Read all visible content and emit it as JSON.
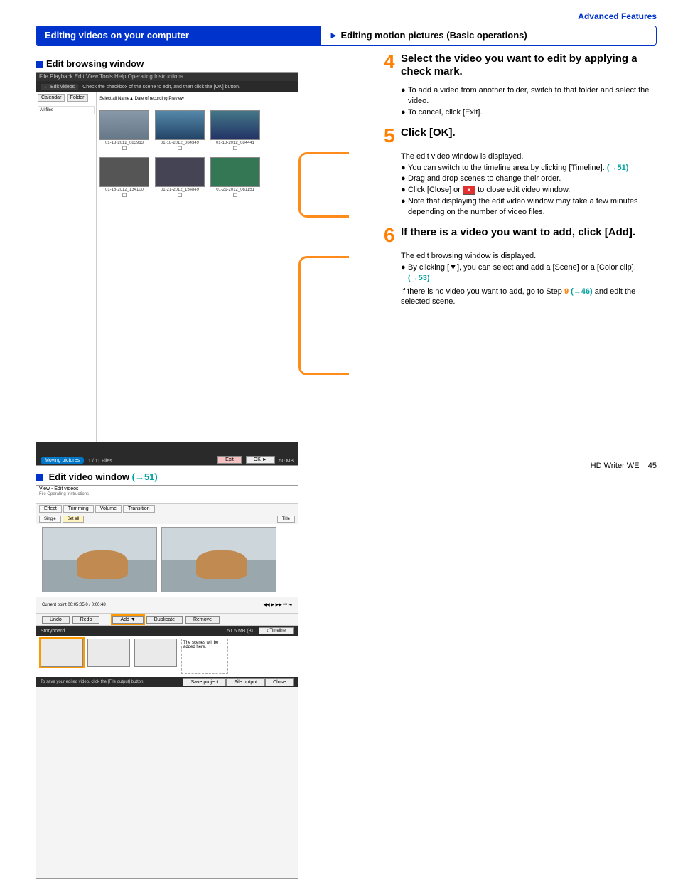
{
  "top_link": "Advanced Features",
  "header": {
    "left": "Editing videos on your computer",
    "right": "Editing motion pictures (Basic operations)"
  },
  "left_col": {
    "heading1": "Edit browsing window",
    "heading2_text": "Edit video window ",
    "heading2_link": "(→51)",
    "browsing": {
      "menu": "File   Playback   Edit   View   Tools   Help   Operating Instructions",
      "back_btn": "← Edit videos",
      "instr": "Check the checkbox of the scene to edit, and then click the [OK] button.",
      "side_tab1": "Calendar",
      "side_tab2": "Folder",
      "side_item": "All files",
      "cols": "Select all        Name▲        Date of recording        Preview",
      "thumbs": [
        {
          "name": "01-18-2012_083913"
        },
        {
          "name": "01-18-2012_084349"
        },
        {
          "name": "01-18-2012_084441"
        },
        {
          "name": "01-18-2012_134100"
        },
        {
          "name": "01-21-2012_154849"
        },
        {
          "name": "01-21-2012_081151"
        }
      ],
      "foot_label": "Moving pictures",
      "foot_count": "1 / 11 Files",
      "foot_exit": "Exit",
      "foot_ok": "OK ►",
      "foot_size": "50 MB"
    },
    "edit": {
      "title": "View - Edit videos",
      "menu": "File   Operating Instructions",
      "tabs": [
        "Effect",
        "Trimming",
        "Volume",
        "Transition"
      ],
      "subtabs": [
        "Single",
        "Set all",
        "Title"
      ],
      "time": "Current point    00:05:05.0 / 0:00:48",
      "btns": [
        "Undo",
        "Redo",
        "",
        "Add ▼",
        "Duplicate",
        "Remove"
      ],
      "story_head": "Storyboard",
      "story_note": "The scenes will be added here.",
      "story_size": "51.5 MB (3)",
      "foot_msg": "To save your edited video, click the [File output] button.",
      "foot_btns": [
        "Save project",
        "File output",
        "Close"
      ]
    }
  },
  "steps": {
    "s4": {
      "num": "4",
      "title": "Select the video you want to edit by applying a check mark.",
      "b1": "To add a video from another folder, switch to that folder and select the video.",
      "b2": "To cancel, click [Exit]."
    },
    "s5": {
      "num": "5",
      "title": "Click [OK].",
      "intro": "The edit video window is displayed.",
      "b1a": "You can switch to the timeline area by clicking [Timeline]. ",
      "b1b": "(→51)",
      "b2": "Drag and drop scenes to change their order.",
      "b3a": "Click [Close] or ",
      "b3b": " to close edit video window.",
      "b4": "Note that displaying the edit video window may take a few minutes depending on the number of video files."
    },
    "s6": {
      "num": "6",
      "title": "If there is a video you want to add, click [Add].",
      "intro": "The edit browsing window is displayed.",
      "b1a": "By clicking [▼], you can select and add a [Scene] or a [Color clip]. ",
      "b1b": "(→53)",
      "t2a": "If there is no video you want to add, go to Step ",
      "t2num": "9",
      "t2b": " ",
      "t2link": "(→46)",
      "t2c": " and edit the selected scene."
    }
  },
  "footer_text": "HD Writer WE",
  "footer_page": "45"
}
